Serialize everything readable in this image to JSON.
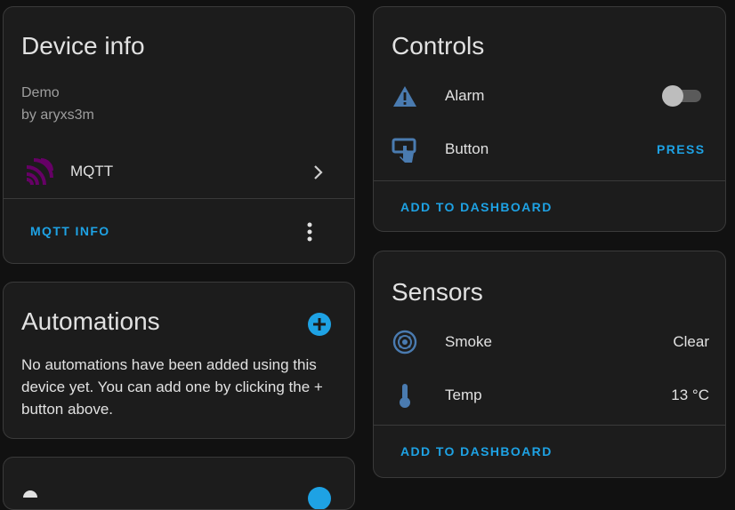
{
  "device_info": {
    "title": "Device info",
    "model": "Demo",
    "manufacturer": "by aryxs3m",
    "integration_label": "MQTT",
    "mqtt_info_label": "MQTT INFO"
  },
  "automations": {
    "title": "Automations",
    "empty_text": "No automations have been added using this device yet. You can add one by clicking the + button above."
  },
  "controls": {
    "title": "Controls",
    "items": [
      {
        "icon": "alert-icon",
        "label": "Alarm",
        "control": "toggle",
        "state": "off"
      },
      {
        "icon": "gesture-tap-button-icon",
        "label": "Button",
        "action_label": "PRESS"
      }
    ],
    "add_to_dashboard_label": "ADD TO DASHBOARD"
  },
  "sensors": {
    "title": "Sensors",
    "items": [
      {
        "icon": "smoke-detector-icon",
        "label": "Smoke",
        "value": "Clear"
      },
      {
        "icon": "thermometer-icon",
        "label": "Temp",
        "value": "13 °C"
      }
    ],
    "add_to_dashboard_label": "ADD TO DASHBOARD"
  },
  "colors": {
    "accent": "#1ea2e4",
    "icon_blue": "#4a7bb0",
    "mqtt_purple": "#660066",
    "card_bg": "#1c1c1c",
    "page_bg": "#111111"
  }
}
